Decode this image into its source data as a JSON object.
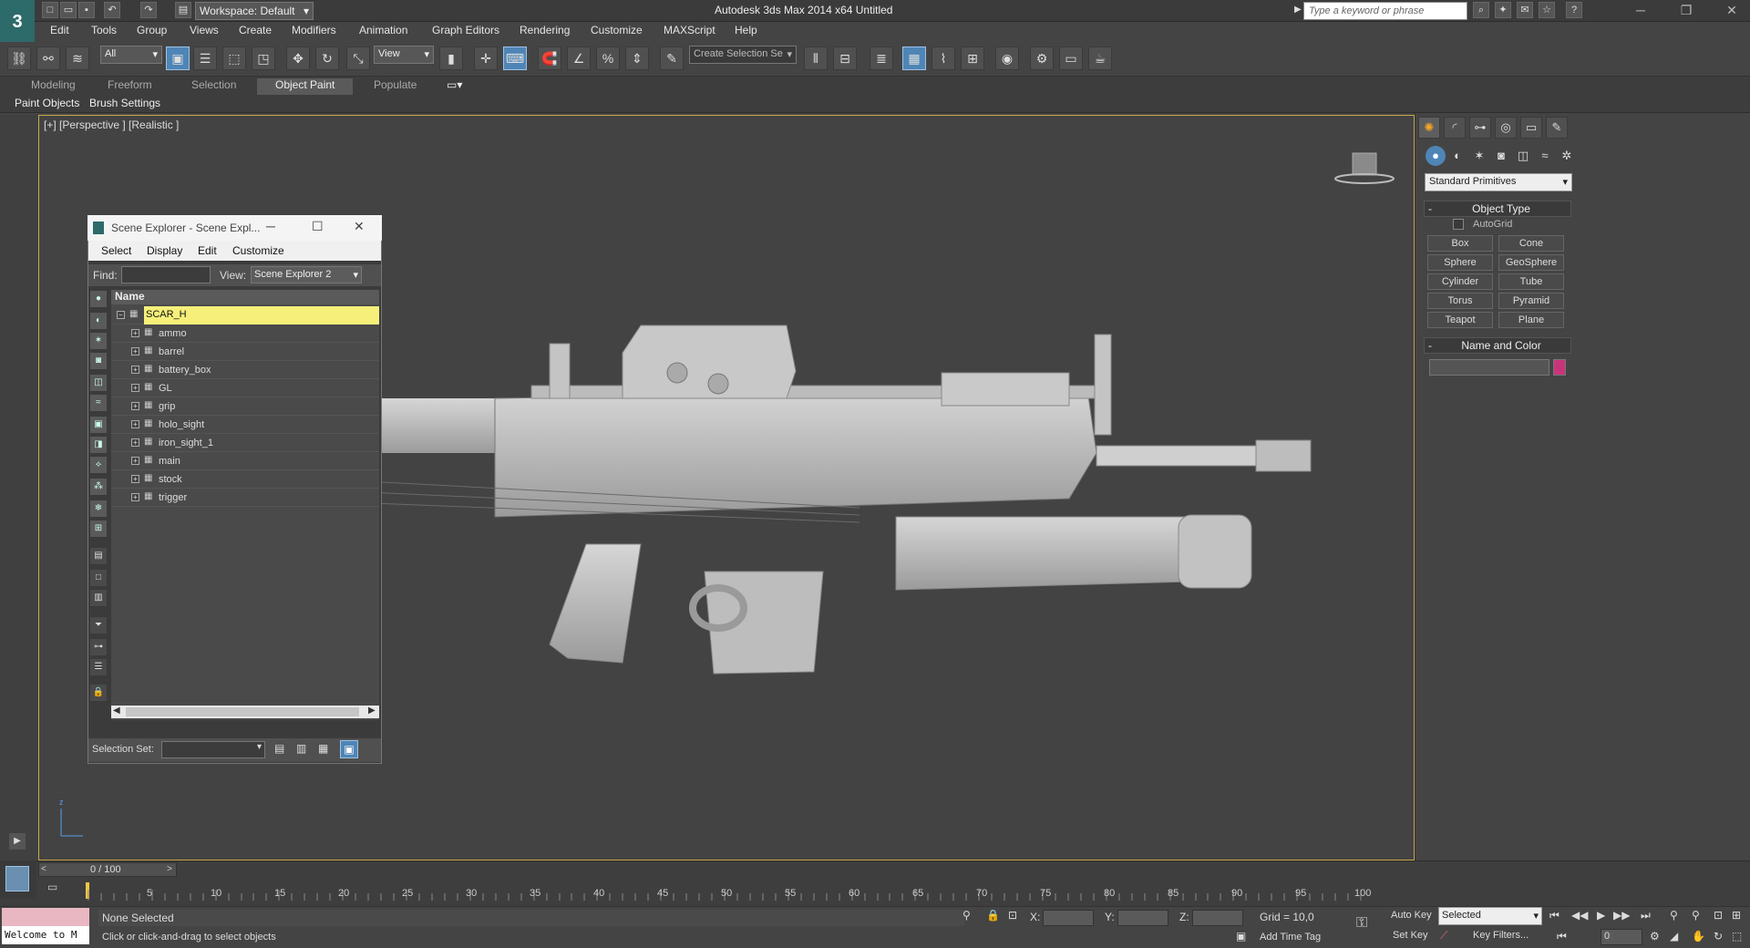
{
  "app": {
    "title": "Autodesk 3ds Max  2014 x64     Untitled",
    "workspace": "Workspace: Default",
    "search_placeholder": "Type a keyword or phrase"
  },
  "menu": [
    "Edit",
    "Tools",
    "Group",
    "Views",
    "Create",
    "Modifiers",
    "Animation",
    "Graph Editors",
    "Rendering",
    "Customize",
    "MAXScript",
    "Help"
  ],
  "toolbar": {
    "filter": "All",
    "ref_coord": "View",
    "selection_set": "Create Selection Se"
  },
  "ribbon": {
    "tabs": [
      "Modeling",
      "Freeform",
      "Selection",
      "Object Paint",
      "Populate"
    ],
    "active_tab": "Object Paint",
    "panels": [
      "Paint Objects",
      "Brush Settings"
    ]
  },
  "viewport": {
    "label": "[+] [Perspective ] [Realistic ]"
  },
  "scene_explorer": {
    "title": "Scene Explorer - Scene Expl...",
    "menu": [
      "Select",
      "Display",
      "Edit",
      "Customize"
    ],
    "find_label": "Find:",
    "view_label": "View:",
    "view_value": "Scene Explorer 2",
    "column_header": "Name",
    "root": "SCAR_H",
    "items": [
      "ammo",
      "barrel",
      "battery_box",
      "GL",
      "grip",
      "holo_sight",
      "iron_sight_1",
      "main",
      "stock",
      "trigger"
    ],
    "selection_set_label": "Selection Set:"
  },
  "command_panel": {
    "category": "Standard Primitives",
    "object_type_header": "Object Type",
    "autogrid_label": "AutoGrid",
    "buttons": [
      "Box",
      "Cone",
      "Sphere",
      "GeoSphere",
      "Cylinder",
      "Tube",
      "Torus",
      "Pyramid",
      "Teapot",
      "Plane"
    ],
    "name_color_header": "Name and Color",
    "swatch_color": "#c8347a"
  },
  "timeline": {
    "frame_display": "0 / 100",
    "ticks": [
      "5",
      "10",
      "15",
      "20",
      "25",
      "30",
      "35",
      "40",
      "45",
      "50",
      "55",
      "60",
      "65",
      "70",
      "75",
      "80",
      "85",
      "90",
      "95",
      "100"
    ]
  },
  "status": {
    "maxscript_listener": "Welcome to M",
    "selection_status": "None Selected",
    "prompt": "Click or click-and-drag to select objects",
    "x_label": "X:",
    "y_label": "Y:",
    "z_label": "Z:",
    "grid": "Grid = 10,0",
    "add_time_tag": "Add Time Tag",
    "auto_key": "Auto Key",
    "set_key": "Set Key",
    "key_mode": "Selected",
    "key_filters": "Key Filters...",
    "frame_field": "0"
  },
  "colors": {
    "viewport_border": "#c9a74a",
    "selected_row": "#f6f07a",
    "active_blue": "#4f85b6"
  }
}
